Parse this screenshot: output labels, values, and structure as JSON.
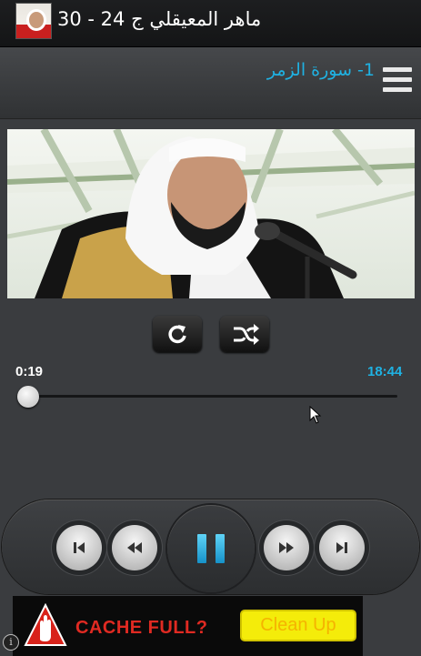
{
  "titlebar": {
    "title": "ماهر المعيقلي ج 24 - 30"
  },
  "header": {
    "track_title": "1- سورة الزمر"
  },
  "player": {
    "elapsed": "0:19",
    "duration": "18:44",
    "progress": 0.017
  },
  "icons": {
    "app": "reciter-portrait-icon",
    "menu": "hamburger-menu-icon",
    "repeat": "repeat-icon",
    "shuffle": "shuffle-icon",
    "prev": "skip-previous-icon",
    "rewind": "rewind-icon",
    "pause": "pause-icon",
    "forward": "fast-forward-icon",
    "next": "skip-next-icon",
    "ad_hand": "stop-hand-icon",
    "ad_info": "info-icon"
  },
  "ad": {
    "text": "CACHE FULL?",
    "button": "Clean Up",
    "info": "i"
  },
  "colors": {
    "accent": "#1fb2e3",
    "background": "#3a3c3f",
    "ad_red": "#e02a22",
    "ad_yellow": "#f4ec0a"
  }
}
